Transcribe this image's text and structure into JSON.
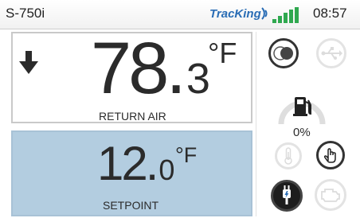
{
  "status_bar": {
    "device_name": "S-750i",
    "brand_prefix": "Trac",
    "brand_suffix": "King",
    "time": "08:57"
  },
  "return_air": {
    "temperature_whole": "78",
    "temperature_decimal": "3",
    "unit": "°F",
    "label": "RETURN AIR",
    "trend": "down"
  },
  "setpoint": {
    "temperature_whole": "12",
    "temperature_decimal": "0",
    "unit": "°F",
    "label": "SETPOINT"
  },
  "fuel": {
    "level_text": "0%",
    "level": 0
  },
  "icons": {
    "toggle": "toggle-icon",
    "usb": "usb-icon",
    "fuel": "fuel-pump-icon",
    "thermometer": "thermometer-icon",
    "touch": "touch-hand-icon",
    "plug": "power-plug-icon",
    "engine": "engine-icon"
  },
  "colors": {
    "setpoint_panel": "#b3cde0",
    "brand_blue": "#2a6db5",
    "signal_green": "#2fa84f"
  }
}
